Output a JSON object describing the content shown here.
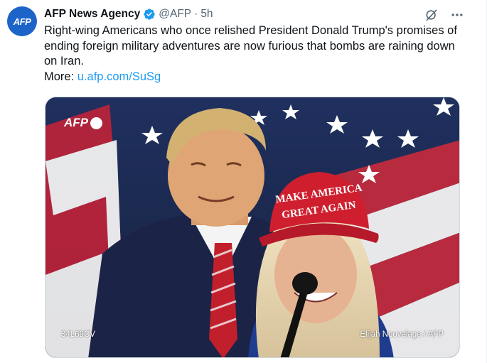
{
  "account": {
    "avatar_text": "AFP",
    "name": "AFP News Agency",
    "handle": "@AFP",
    "separator": "·",
    "time": "5h"
  },
  "tweet": {
    "text": "Right-wing Americans who once relished President Donald Trump's promises of ending foreign military adventures are now furious that bombs are raining down on Iran.",
    "more_label": "More:",
    "link": "u.afp.com/SuSg"
  },
  "media": {
    "watermark_logo": "AFP",
    "hat_text_line1": "MAKE AMERICA",
    "hat_text_line2": "GREAT AGAIN",
    "photo_id": "34L69CV",
    "credit": "Elijah Nouvelage / AFP"
  },
  "icons": {
    "verified": "verified-badge-icon",
    "grok": "grok-icon",
    "more": "more-icon"
  },
  "colors": {
    "accent": "#1d9bf0",
    "avatar_bg": "#1d64c8",
    "text": "#0f1419",
    "muted": "#536471"
  }
}
